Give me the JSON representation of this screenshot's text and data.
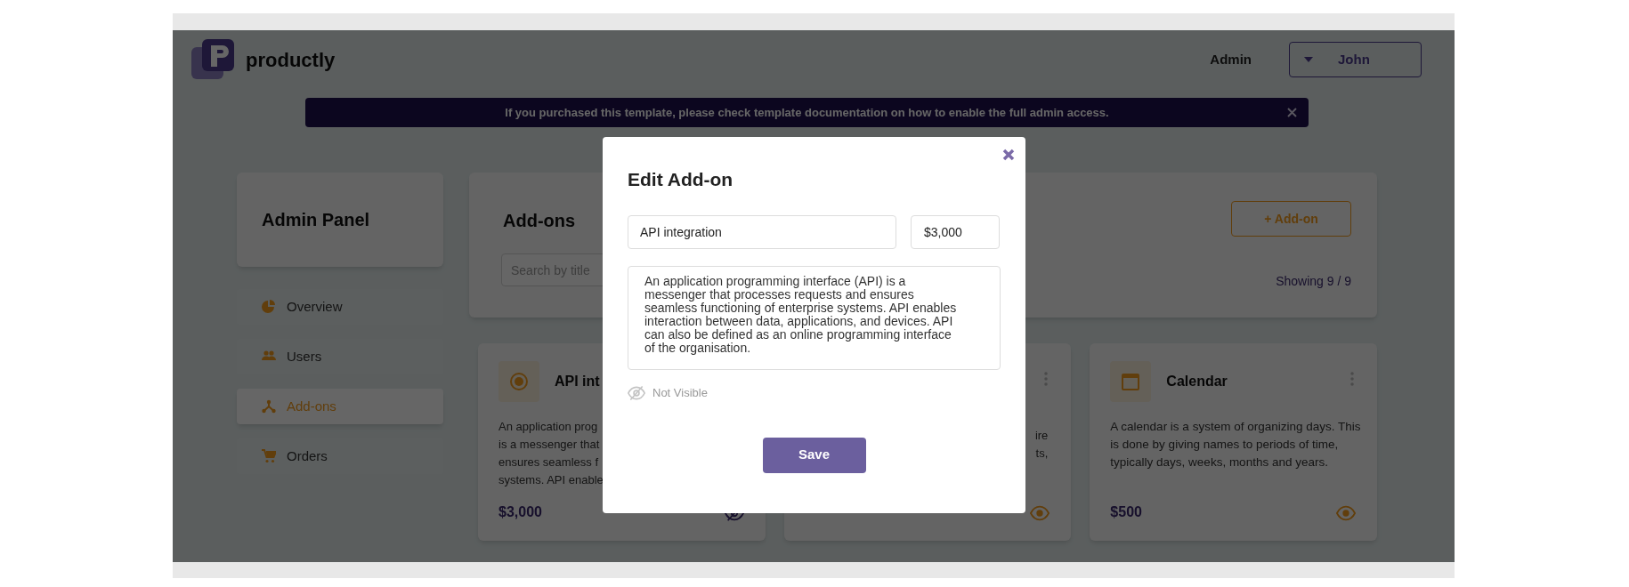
{
  "header": {
    "logo": "productly",
    "user_role": "Admin",
    "user_menu": "John"
  },
  "banner": {
    "text": "If you purchased this template, please check **template documentation** on how to enable the full admin access."
  },
  "sidebar": {
    "title": "Admin Panel",
    "items": [
      {
        "label": "Overview",
        "selected": false
      },
      {
        "label": "Users",
        "selected": false
      },
      {
        "label": "Add-ons",
        "selected": true
      },
      {
        "label": "Orders",
        "selected": false
      }
    ]
  },
  "main": {
    "title": "Add-ons",
    "search": {
      "placeholder": "Search by title"
    },
    "add_button": "+ Add-on",
    "count": "Showing 9 / 9"
  },
  "cards": [
    {
      "kind": "partial",
      "title": "API int",
      "lines": [
        "An application prog",
        "is a messenger that",
        "ensures seamless f",
        "systems. API enable"
      ],
      "price": "$3,000",
      "visible": false
    },
    {
      "kind": "covered",
      "lines": [
        "ire",
        "ts,"
      ],
      "visible": true
    },
    {
      "kind": "full",
      "title": "Calendar",
      "description": "A calendar is a system of organizing days. This is done by giving names to periods of time, typically days, weeks, months and years.",
      "price": "$500",
      "visible": true
    }
  ],
  "modal": {
    "title": "Edit Add-on",
    "name": "API integration",
    "price": "$3,000",
    "description": "An application programming interface (API) is a messenger that processes requests and ensures seamless functioning of enterprise systems. API enables interaction between data, applications, and devices. API can also be defined as an online programming interface of the organisation.",
    "visibility": {
      "label": "Not Visible",
      "visible": false
    },
    "save": "Save"
  }
}
